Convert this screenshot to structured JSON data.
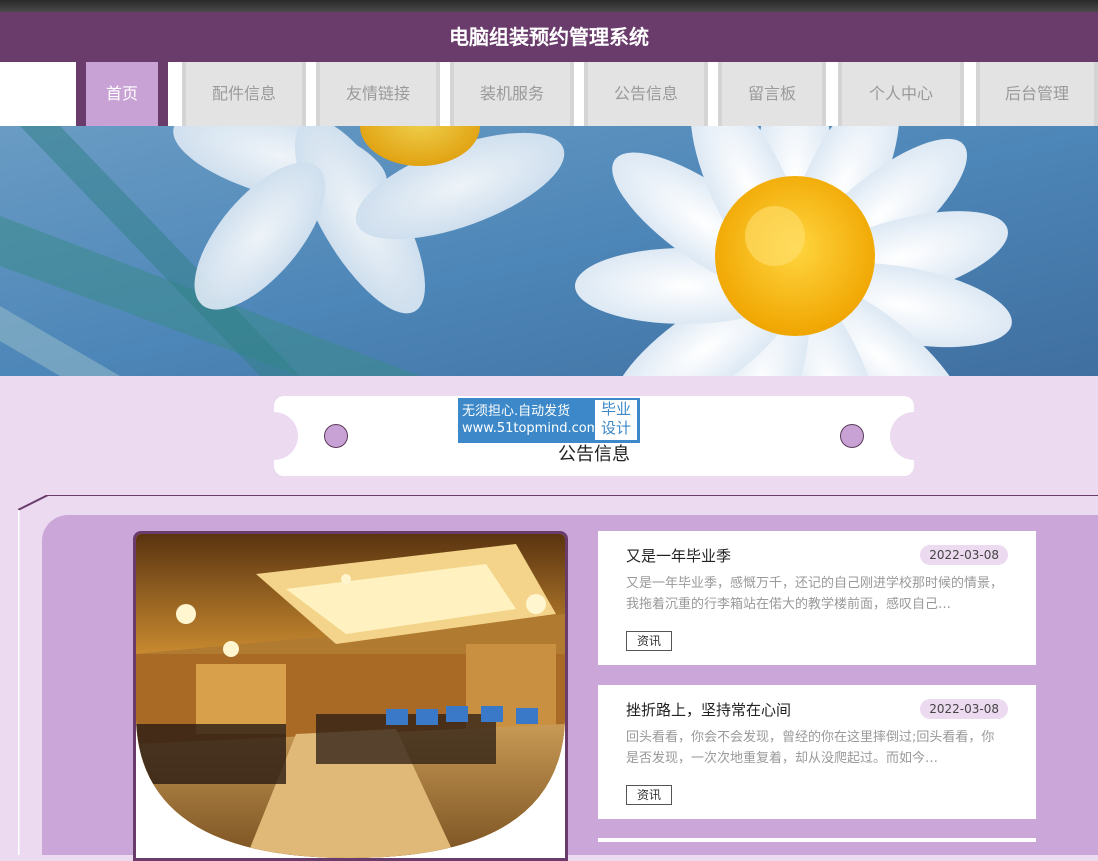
{
  "header": {
    "title": "电脑组装预约管理系统"
  },
  "nav": {
    "items": [
      {
        "label": "首页",
        "active": true
      },
      {
        "label": "配件信息"
      },
      {
        "label": "友情链接"
      },
      {
        "label": "装机服务"
      },
      {
        "label": "公告信息"
      },
      {
        "label": "留言板"
      },
      {
        "label": "个人中心"
      },
      {
        "label": "后台管理"
      }
    ]
  },
  "section": {
    "title": "公告信息"
  },
  "watermark": {
    "line1": "无须担心.自动发货",
    "line2": "www.51topmind.com",
    "badge_line1": "毕业",
    "badge_line2": "设计"
  },
  "news": [
    {
      "title": "又是一年毕业季",
      "date": "2022-03-08",
      "excerpt": "又是一年毕业季，感慨万千，还记的自己刚进学校那时候的情景，我拖着沉重的行李箱站在偌大的教学楼前面，感叹自己…",
      "tag": "资讯"
    },
    {
      "title": "挫折路上，坚持常在心间",
      "date": "2022-03-08",
      "excerpt": "回头看看，你会不会发现，曾经的你在这里摔倒过;回头看看，你是否发现，一次次地重复着，却从没爬起过。而如今…",
      "tag": "资讯"
    }
  ],
  "colors": {
    "primary": "#6a3c6c",
    "accent": "#c8a2d4",
    "page_bg": "#ecdaf0"
  }
}
